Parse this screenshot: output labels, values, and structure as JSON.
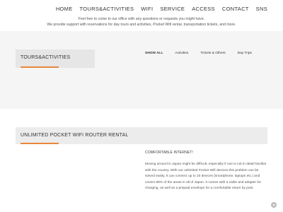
{
  "nav": {
    "items": [
      "HOME",
      "TOURS&ACTIVITIES",
      "WIFI",
      "SERVICE",
      "ACCESS",
      "CONTACT",
      "SNS"
    ],
    "intro_line1": "Feel free to come to our office with any questions or requests you might have.",
    "intro_line2": "We provide support with reservations for day tours and activities, Pocket Wifi rental, transportation tickets, and more."
  },
  "tours": {
    "title": "TOURS&ACTIVITIES",
    "filters": [
      "SHOW ALL",
      "Activities",
      "Tickets & Others",
      "Day Trips"
    ]
  },
  "wifi": {
    "title": "UNLIMITED POCKET WIFI ROUTER RENTAL",
    "subtitle": "COMFORTABLE INTERNET!",
    "body": "Moving around in Japan might be difficult, especially if one is not in detail familiar with the country. With our unlimited Pocket Wifi devices this problem can be solved easily. It can connect up to 10 devices (smartphone, laptops etc.) and covers 99% of the areas in all of Japan. It comes with a cable and adapter for charging, as well as a prepaid envelope for a comfortable return by post."
  },
  "colors": {
    "accent": "#e8863a"
  },
  "icons": {
    "scroll_top": "chevron-up-icon"
  }
}
